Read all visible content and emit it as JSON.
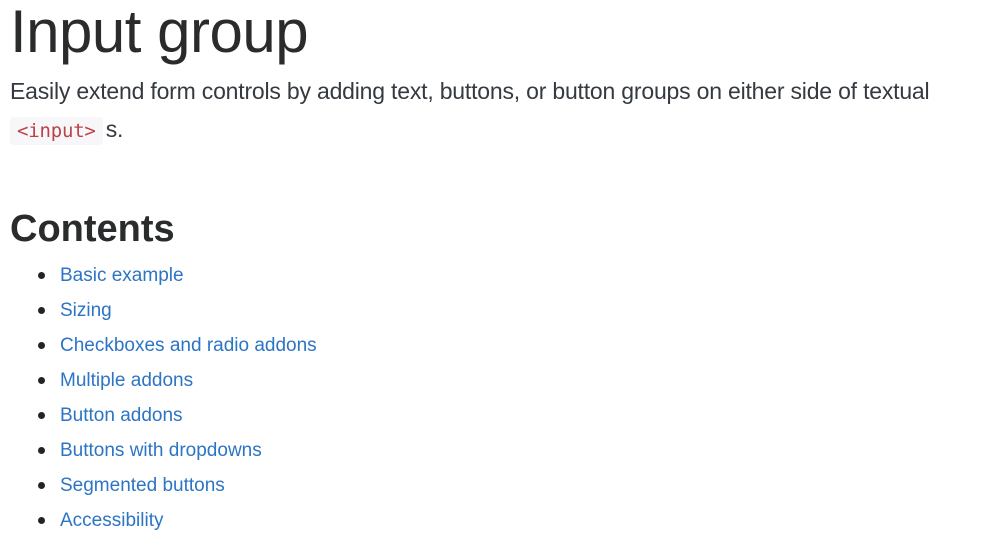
{
  "header": {
    "title": "Input group",
    "lead_text": "Easily extend form controls by adding text, buttons, or button groups on either side of textual",
    "lead_code": "<input>",
    "lead_suffix": "s."
  },
  "contents": {
    "title": "Contents",
    "items": [
      {
        "label": "Basic example"
      },
      {
        "label": "Sizing"
      },
      {
        "label": "Checkboxes and radio addons"
      },
      {
        "label": "Multiple addons"
      },
      {
        "label": "Button addons"
      },
      {
        "label": "Buttons with dropdowns"
      },
      {
        "label": "Segmented buttons"
      },
      {
        "label": "Accessibility"
      }
    ]
  },
  "colors": {
    "text": "#292b2c",
    "link": "#2c74c4",
    "code_text": "#bd4147",
    "code_bg": "#f7f7f9"
  }
}
